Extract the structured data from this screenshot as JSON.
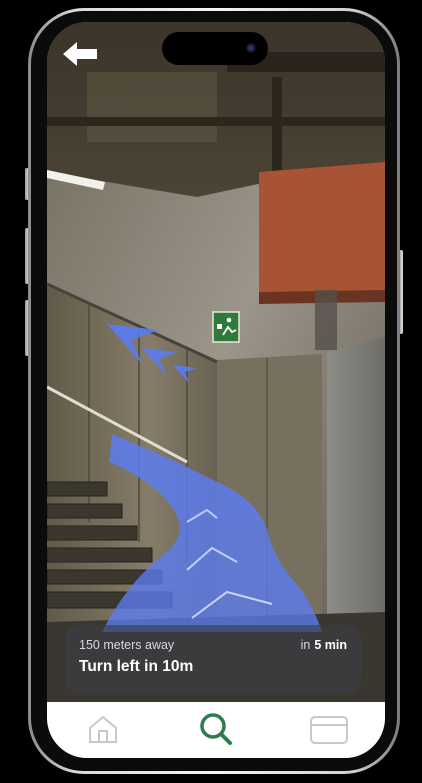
{
  "navigation": {
    "distance_text": "150 meters away",
    "eta_prefix": "in",
    "eta_value": "5 min",
    "instruction": "Turn left in 10m"
  },
  "tab_bar": {
    "tabs": [
      {
        "id": "home",
        "icon": "home-icon",
        "active": false
      },
      {
        "id": "search",
        "icon": "search-icon",
        "active": true
      },
      {
        "id": "card",
        "icon": "card-icon",
        "active": false
      }
    ]
  },
  "colors": {
    "ar_path": "#5b7cf0",
    "active_tab": "#2e7d4f",
    "inactive_tab": "#c8c8c8",
    "card_bg": "rgba(60,62,70,0.62)"
  },
  "icons": {
    "back": "back-arrow-icon",
    "exit_sign": "emergency-exit-sign-icon"
  }
}
